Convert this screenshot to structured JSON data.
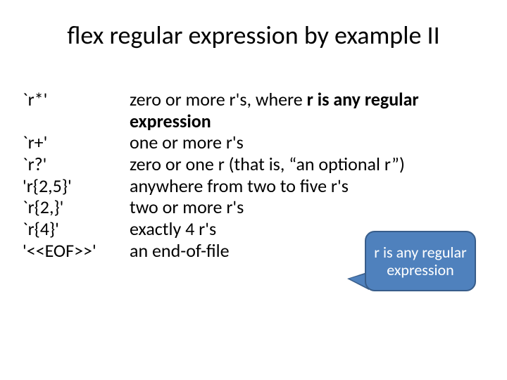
{
  "title": "flex regular expression by example II",
  "rows": [
    {
      "pattern": "`r*'",
      "desc_pre": "zero or more r's, where ",
      "desc_bold": "r is any regular expression",
      "desc_post": ""
    },
    {
      "pattern": "`r+'",
      "desc_pre": "one or more r's",
      "desc_bold": "",
      "desc_post": ""
    },
    {
      "pattern": "`r?'",
      "desc_pre": "zero or one r (that is, “an optional r”)",
      "desc_bold": "",
      "desc_post": ""
    },
    {
      "pattern": "'r{2,5}'",
      "desc_pre": "anywhere from two to five r's",
      "desc_bold": "",
      "desc_post": ""
    },
    {
      "pattern": "`r{2,}'",
      "desc_pre": "two or more r's",
      "desc_bold": "",
      "desc_post": ""
    },
    {
      "pattern": "`r{4}'",
      "desc_pre": "exactly 4 r's",
      "desc_bold": "",
      "desc_post": ""
    },
    {
      "pattern": "'<<EOF>>'",
      "desc_pre": "an end-of-file",
      "desc_bold": "",
      "desc_post": ""
    }
  ],
  "callout": "r is any regular expression"
}
